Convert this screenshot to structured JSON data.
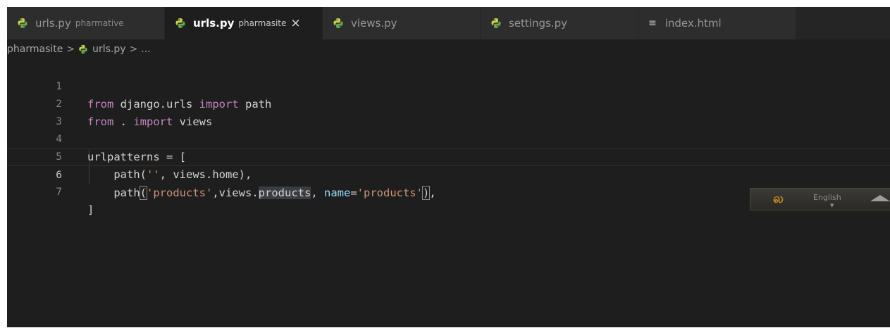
{
  "tabs": [
    {
      "name": "urls.py",
      "description": "pharmative",
      "icon": "python-icon",
      "active": false
    },
    {
      "name": "urls.py",
      "description": "pharmasite",
      "icon": "python-icon",
      "active": true,
      "close": "×"
    },
    {
      "name": "views.py",
      "description": "",
      "icon": "python-icon",
      "active": false
    },
    {
      "name": "settings.py",
      "description": "",
      "icon": "python-icon",
      "active": false
    },
    {
      "name": "index.html",
      "description": "",
      "icon": "lines-icon",
      "active": false
    }
  ],
  "breadcrumb": {
    "folder": "pharmasite",
    "separator": ">",
    "file": "urls.py",
    "more": "..."
  },
  "editor": {
    "current_line": 6,
    "line_numbers": [
      "1",
      "2",
      "3",
      "4",
      "5",
      "6",
      "7"
    ],
    "line1": {
      "kw1": "from",
      "mid": " django.urls ",
      "kw2": "import",
      "end": " path"
    },
    "line2": {
      "kw1": "from",
      "mid": " . ",
      "kw2": "import",
      "end": " views"
    },
    "line4": {
      "text": "urlpatterns = ["
    },
    "line5": {
      "pre": "    path(",
      "str": "''",
      "post": ", views.home),"
    },
    "line6": {
      "pre": "    path",
      "open": "(",
      "str1": "'products'",
      "mid": ",views.",
      "hl": "products",
      "comma": ", ",
      "param": "name",
      "eq": "=",
      "str2": "'products'",
      "close": ")",
      "end": ","
    },
    "line7": {
      "text": "]"
    }
  },
  "language_widget": {
    "glyph": "ல",
    "label": "English"
  },
  "colors": {
    "background": "#1e1e1e",
    "keyword": "#c586c0",
    "string": "#ce9178",
    "parameter": "#9cdcfe",
    "text": "#d4d4d4"
  }
}
